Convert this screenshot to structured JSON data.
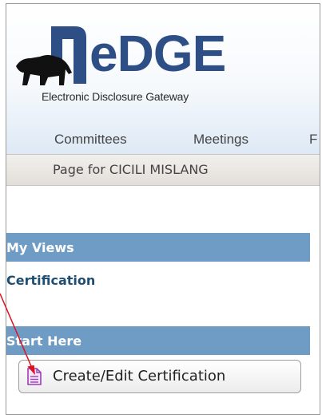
{
  "app": {
    "logo_text": "eDGE",
    "tagline": "Electronic Disclosure Gateway"
  },
  "nav": {
    "items": [
      "Committees",
      "Meetings",
      "F"
    ]
  },
  "page_bar": {
    "text": "Page for CICILI MISLANG"
  },
  "sections": {
    "my_views": {
      "title": "My Views",
      "links": [
        "Certification"
      ]
    },
    "start_here": {
      "title": "Start Here",
      "button_label": "Create/Edit Certification"
    }
  },
  "colors": {
    "logo_blue": "#2e4f86",
    "section_bar": "#6f9cc4",
    "link_blue": "#1f4e73",
    "annotation_arrow": "#e01020",
    "doc_icon": "#9b3fb5"
  },
  "icons": {
    "logo_mark": "bear-logo-icon",
    "button_icon": "document-icon"
  }
}
